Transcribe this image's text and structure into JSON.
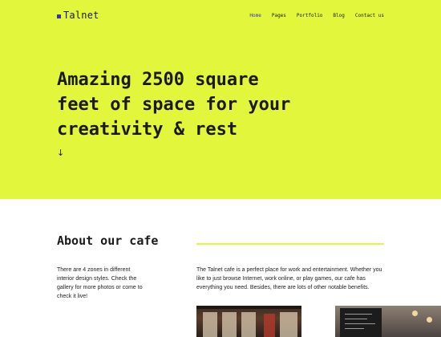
{
  "header": {
    "logo_text": "Talnet",
    "nav": [
      {
        "label": "Home",
        "active": true
      },
      {
        "label": "Pages",
        "active": false
      },
      {
        "label": "Portfolio",
        "active": false
      },
      {
        "label": "Blog",
        "active": false
      },
      {
        "label": "Contact us",
        "active": false
      }
    ]
  },
  "hero": {
    "headline_lines": [
      "Amazing 2500 square",
      "feet of space for your",
      "creativity & rest"
    ],
    "scroll_arrow": "↓",
    "background_color": "#e2f73c"
  },
  "about": {
    "title": "About our cafe",
    "left_text": "There are 4 zones in different interior design styles. Check the gallery for more photos or come to check it live!",
    "right_text": "The Talnet cafe is a perfect place for work and entertainment. Whether you like to just browse Internet, work online, or play games, our cafe has everything you need. Besides, there are lots of other notable benefits."
  },
  "colors": {
    "accent": "#e2f73c",
    "nav_active": "#3b32a8"
  }
}
